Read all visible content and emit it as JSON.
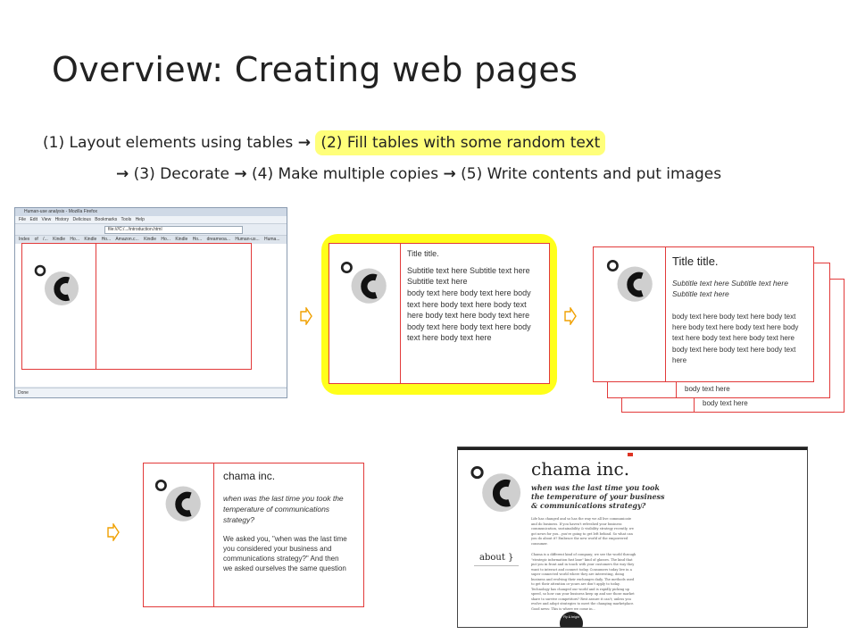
{
  "slide": {
    "title": "Overview: Creating web pages",
    "steps_line1": {
      "s1": "(1) Layout elements using tables ",
      "s2": "(2) Fill tables with some random text"
    },
    "steps_line2": {
      "s3": " (3) Decorate ",
      "s4": " (4) Make multiple copies ",
      "s5": " (5) Write contents and put images"
    },
    "arrow_glyph": "→",
    "accent_color": "#e23a3a",
    "highlight_color": "#ffff1a"
  },
  "browser": {
    "window_title": "Human-use analysis - Mozilla Firefox",
    "menu": "File Edit View History Delicious Bookmarks Tools Help",
    "url": "file:///C:/.../introduction.html",
    "tabs": "Index of /... Kindle Ho... Kindle Ho... Amazon.c... Kindle Ho... Kindle Ho... dreamvoa... Human-us... Huma...",
    "status": "Done"
  },
  "card2": {
    "title": "Title title.",
    "subtitle": "Subtitle text here Subtitle text here Subtitle text here",
    "body": "body text here body text here body text here body text here body text here body text here body text here body text here body text here body text here body text here"
  },
  "card3": {
    "title": "Title title.",
    "subtitle": "Subtitle text here Subtitle text here Subtitle text here",
    "body": "body text here body text here body text here body text here body text here body text here body text here body text here body text here body text here body text here",
    "copy1_tail": "body text here",
    "copy2_tail": "body text here"
  },
  "card4": {
    "title": "chama inc.",
    "tagline": "when was the last time you took the temperature of communications strategy?",
    "body": "We asked you, \"when was the last time you considered your business and communications strategy?\" And then we asked ourselves the same question"
  },
  "site": {
    "headline": "chama inc.",
    "tagline": "when was the last time you took the temperature of your business & communications strategy?",
    "para1": "Life has changed and so has the way we all live communicate and do business. If you haven't refreshed your business communication, sustainability & visibility strategy recently, we got news for you...you're going to get left behind. So what can you do about it? Embrace the new world of the empowered consumer.",
    "para2": "Chama is a different kind of company; we see the world through \"strategic information fast lane\" kind of glasses. The kind that put you in front and in touch with your customers the way they want to interact and connect today. Consumers today live in a super connected world where they are interesting, doing business and evolving their exchanges daily. The methods used to get their attention or yours are don't apply to today. Technology has changed our world and is rapidly picking up speed, so how can your business keep up and use those market share to survive competitors? Rest assure it can't; unless you evolve and adopt strategies to meet the changing marketplace. Good news: This is where we come in...",
    "about": "about }",
    "badge": "Fly & bright"
  }
}
